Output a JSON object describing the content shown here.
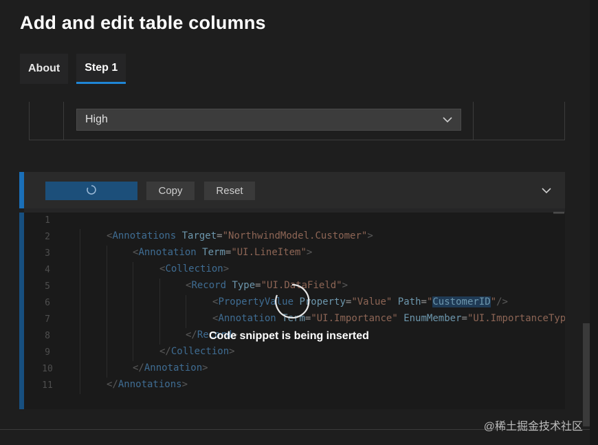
{
  "page": {
    "title": "Add and edit table columns"
  },
  "tabs": [
    {
      "label": "About",
      "active": false
    },
    {
      "label": "Step 1",
      "active": true
    }
  ],
  "table": {
    "importance_value": "High"
  },
  "toolbar": {
    "insert_label": "",
    "copy_label": "Copy",
    "reset_label": "Reset"
  },
  "code": {
    "line_numbers": [
      "1",
      "2",
      "3",
      "4",
      "5",
      "6",
      "7",
      "8",
      "9",
      "10",
      "11"
    ]
  },
  "loading": {
    "message": "Code snippet is being inserted"
  },
  "watermark": "@稀土掘金技术社区",
  "colors": {
    "accent": "#1a6fb8",
    "tab_underline": "#1f86d6",
    "tag": "#569cd6",
    "attr": "#9cdcfe",
    "string": "#ce9178"
  }
}
